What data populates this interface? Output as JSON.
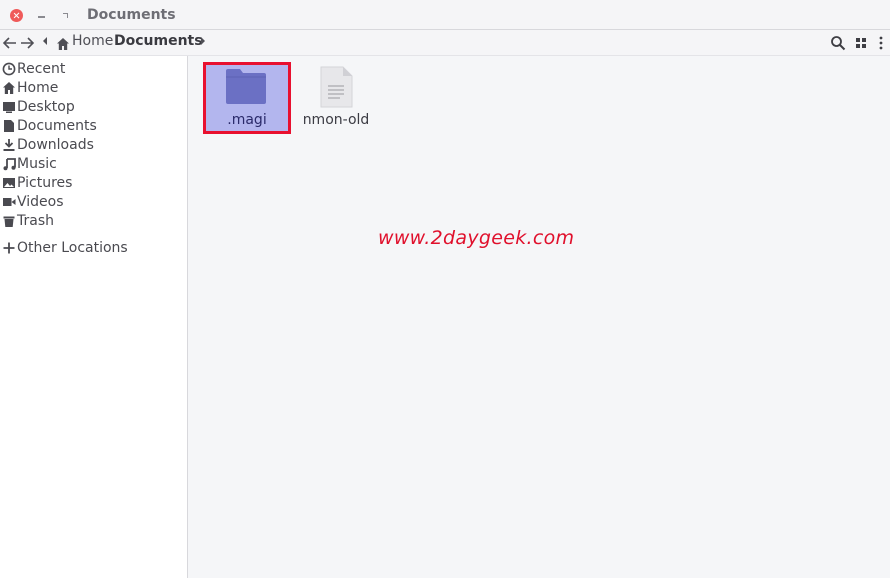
{
  "window": {
    "title": "Documents"
  },
  "toolbar": {
    "breadcrumb": [
      "Home",
      "Documents"
    ],
    "icons": [
      "back-arrow-icon",
      "forward-arrow-icon",
      "search-icon",
      "grid-view-icon",
      "kebab-menu-icon"
    ]
  },
  "sidebar": {
    "items": [
      {
        "label": "Recent",
        "icon": "clock-icon"
      },
      {
        "label": "Home",
        "icon": "home-icon"
      },
      {
        "label": "Desktop",
        "icon": "desktop-icon"
      },
      {
        "label": "Documents",
        "icon": "document-icon"
      },
      {
        "label": "Downloads",
        "icon": "download-icon"
      },
      {
        "label": "Music",
        "icon": "music-icon"
      },
      {
        "label": "Pictures",
        "icon": "picture-icon"
      },
      {
        "label": "Videos",
        "icon": "video-icon"
      },
      {
        "label": "Trash",
        "icon": "trash-icon"
      },
      {
        "label": "Other Locations",
        "icon": "plus-icon"
      }
    ]
  },
  "files": [
    {
      "name": ".magi",
      "type": "folder",
      "selected": true
    },
    {
      "name": "nmon-old",
      "type": "text-file",
      "selected": false
    }
  ],
  "watermark": "www.2daygeek.com",
  "colors": {
    "selection": "#b3b6ee",
    "highlight_border": "#e8102f",
    "folder": "#6b70c4",
    "watermark": "#e0102c",
    "close_button": "#ef5a5a"
  }
}
